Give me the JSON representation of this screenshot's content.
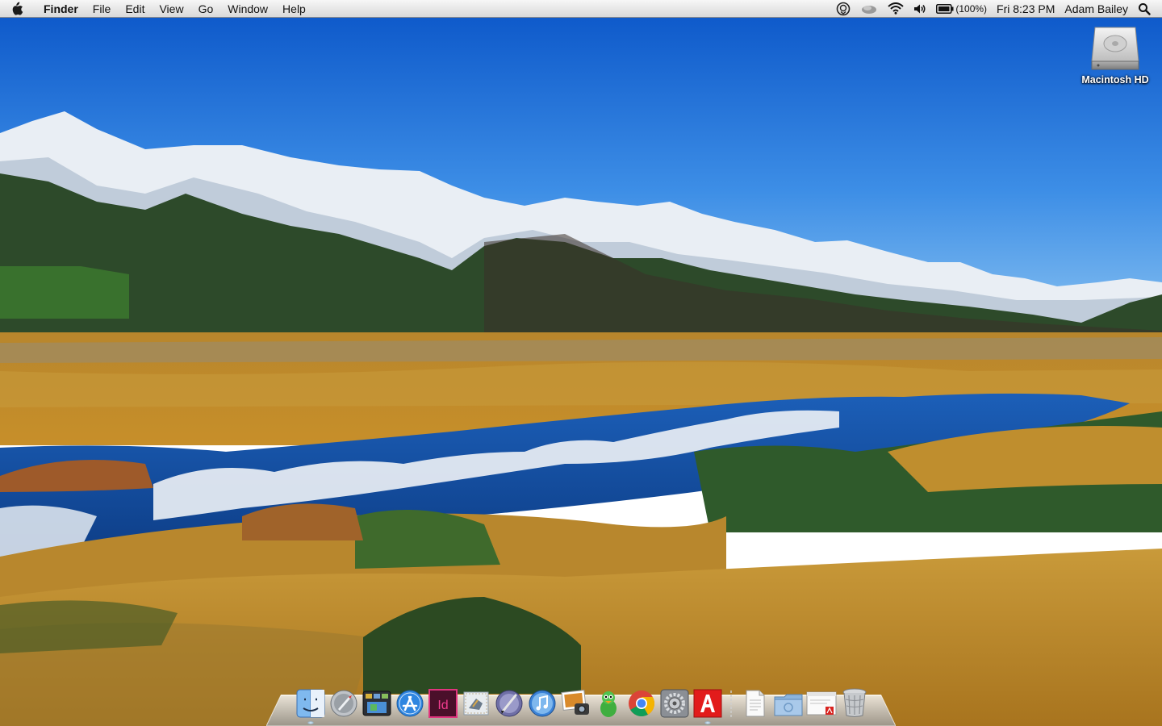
{
  "menubar": {
    "app_name": "Finder",
    "menus": [
      "File",
      "Edit",
      "View",
      "Go",
      "Window",
      "Help"
    ],
    "status": {
      "battery_percent": "(100%)",
      "clock": "Fri 8:23 PM",
      "user_name": "Adam Bailey"
    },
    "status_icons": [
      "chat-icon",
      "cloud-icon",
      "wifi-icon",
      "volume-icon",
      "battery-icon",
      "spotlight-search-icon"
    ]
  },
  "desktop": {
    "icons": [
      {
        "label": "Macintosh HD",
        "icon": "hard-drive-icon"
      }
    ],
    "wallpaper": "mountain-lake-landscape"
  },
  "dock": {
    "apps": [
      {
        "name": "finder",
        "icon": "finder-icon",
        "running": true
      },
      {
        "name": "launchpad",
        "icon": "launchpad-icon",
        "running": false
      },
      {
        "name": "mission-control",
        "icon": "mission-control-icon",
        "running": false
      },
      {
        "name": "app-store",
        "icon": "app-store-icon",
        "running": false
      },
      {
        "name": "indesign",
        "icon": "indesign-icon",
        "running": false
      },
      {
        "name": "mail",
        "icon": "mail-icon",
        "running": false
      },
      {
        "name": "script-editor",
        "icon": "script-editor-icon",
        "running": false
      },
      {
        "name": "itunes",
        "icon": "itunes-icon",
        "running": false
      },
      {
        "name": "iphoto",
        "icon": "iphoto-icon",
        "running": false
      },
      {
        "name": "adium",
        "icon": "adium-icon",
        "running": false
      },
      {
        "name": "chrome",
        "icon": "chrome-icon",
        "running": false
      },
      {
        "name": "system-preferences",
        "icon": "system-preferences-icon",
        "running": false
      },
      {
        "name": "adobe-application-manager",
        "icon": "adobe-icon",
        "running": true
      }
    ],
    "stacks": [
      {
        "name": "document",
        "icon": "document-icon"
      },
      {
        "name": "folder",
        "icon": "folder-icon"
      },
      {
        "name": "pdf-document",
        "icon": "pdf-document-icon"
      },
      {
        "name": "trash",
        "icon": "trash-icon"
      }
    ]
  }
}
